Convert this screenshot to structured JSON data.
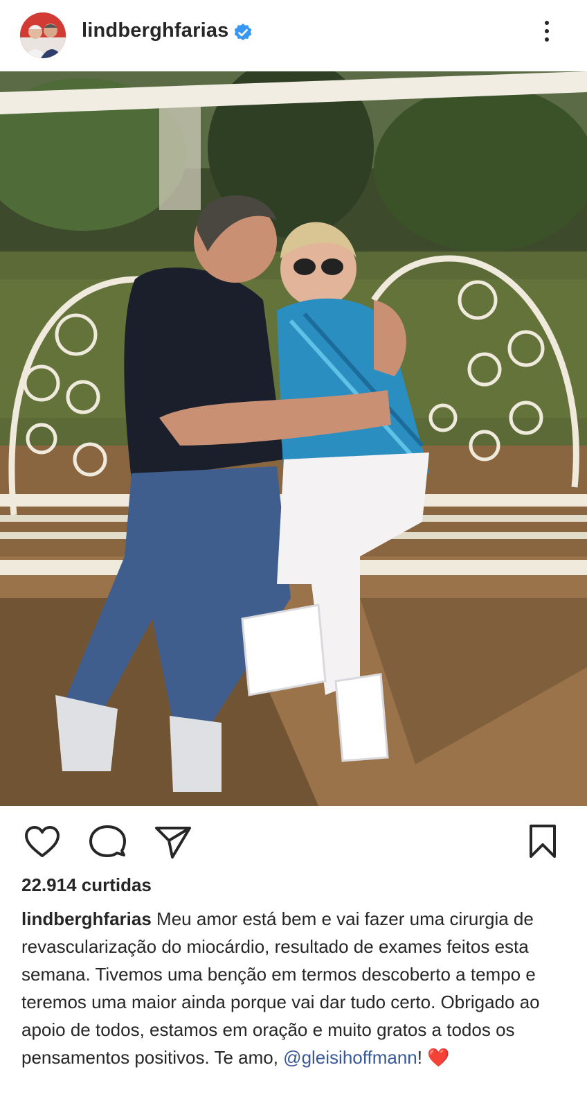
{
  "post": {
    "username": "lindberghfarias",
    "verified": true,
    "likes_text": "22.914 curtidas",
    "caption_user": "lindberghfarias",
    "caption_text": " Meu amor está bem e vai fazer uma cirurgia de revascularização do miocárdio, resultado de exames feitos esta semana. Tivemos uma benção em termos descoberto a tempo e teremos uma maior ainda porque vai dar tudo certo. Obrigado ao apoio de todos, estamos em oração e muito gratos a todos os pensamentos positivos. Te amo, ",
    "caption_mention": "@gleisihoffmann",
    "caption_end": "!",
    "caption_emoji": "❤️"
  },
  "icons": {
    "verified": "verified-badge-icon",
    "more": "more-options-icon",
    "like": "heart-outline-icon",
    "comment": "comment-bubble-icon",
    "share": "paper-plane-icon",
    "save": "bookmark-icon"
  },
  "colors": {
    "text": "#262626",
    "verified_blue": "#3897f0",
    "mention": "#385898",
    "heart": "#e0151f"
  }
}
